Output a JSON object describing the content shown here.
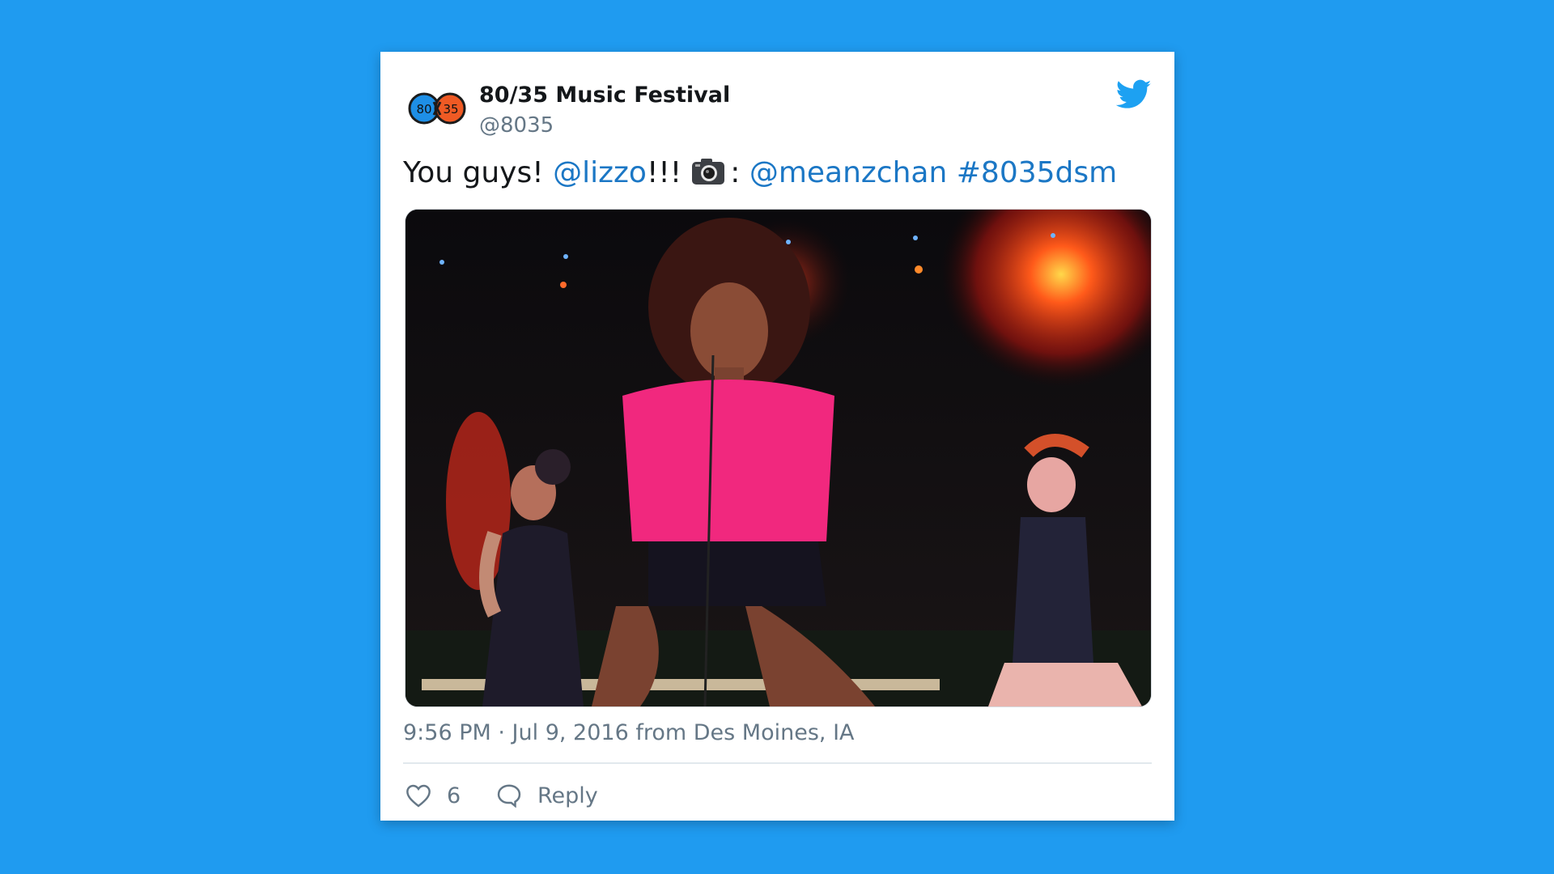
{
  "tweet": {
    "display_name": "80/35 Music Festival",
    "handle": "@8035",
    "avatar_left_text": "80",
    "avatar_right_text": "35",
    "text_plain_1": "You guys! ",
    "mention_1": "@lizzo",
    "text_plain_2": "!!!",
    "text_plain_3": ": ",
    "mention_2": "@meanzchan",
    "hashtag": "#8035dsm",
    "camera_icon": "camera-icon",
    "timestamp": "9:56 PM · Jul 9, 2016 from Des Moines, IA",
    "like_count": "6",
    "reply_label": "Reply"
  },
  "icons": {
    "brand": "twitter-bird-icon",
    "like": "heart-icon",
    "reply": "speech-bubble-icon"
  },
  "colors": {
    "background": "#1f9bf0",
    "card": "#ffffff",
    "link": "#1b77c5",
    "muted": "#657786",
    "avatar_left": "#1e8fe6",
    "avatar_right": "#ef5a24"
  }
}
